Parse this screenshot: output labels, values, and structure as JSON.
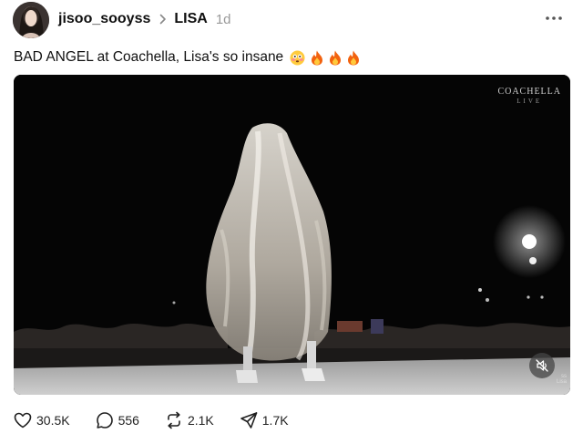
{
  "post": {
    "author": "jisoo_sooyss",
    "community": "LISA",
    "time": "1d",
    "caption": "BAD ANGEL at Coachella, Lisa's so insane"
  },
  "video": {
    "watermark_main": "COACHELLA",
    "watermark_sub": "LIVE",
    "credit_line1": "ss",
    "credit_line2": "Lisa"
  },
  "actions": {
    "likes": "30.5K",
    "comments": "556",
    "reposts": "2.1K",
    "shares": "1.7K"
  },
  "icons": {
    "more": "more-horizontal-icon",
    "like": "heart-icon",
    "comment": "comment-bubble-icon",
    "repost": "repost-icon",
    "share": "send-icon",
    "mute": "muted-speaker-icon"
  },
  "colors": {
    "text": "#0f0f0f",
    "muted": "#999999",
    "fire": "#f2620f"
  }
}
